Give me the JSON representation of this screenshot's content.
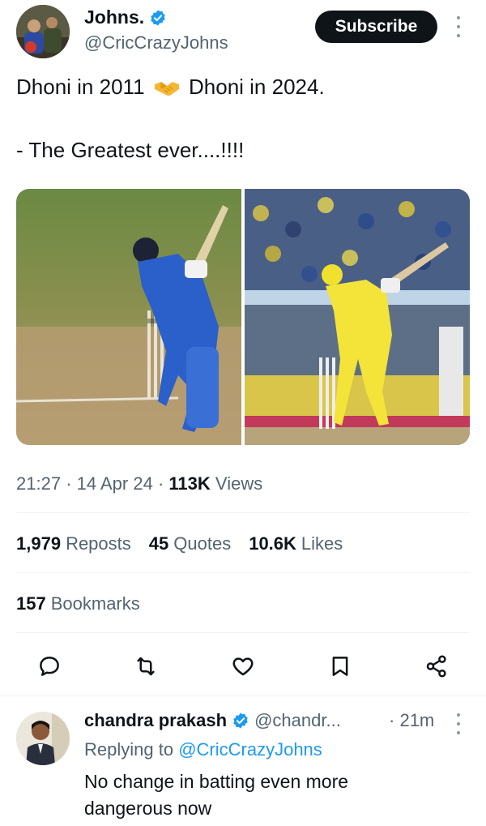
{
  "author": {
    "display_name": "Johns.",
    "handle": "@CricCrazyJohns",
    "verified_icon": "verified-badge-icon"
  },
  "subscribe_label": "Subscribe",
  "tweet": {
    "text_part1": "Dhoni in 2011",
    "emoji": "handshake-icon",
    "text_part2": "Dhoni in 2024.",
    "line2": "- The Greatest ever....!!!!"
  },
  "meta": {
    "time": "21:27",
    "date": "14 Apr 24",
    "views_count": "113K",
    "views_label": "Views"
  },
  "stats": {
    "reposts_count": "1,979",
    "reposts_label": "Reposts",
    "quotes_count": "45",
    "quotes_label": "Quotes",
    "likes_count": "10.6K",
    "likes_label": "Likes",
    "bookmarks_count": "157",
    "bookmarks_label": "Bookmarks"
  },
  "reply": {
    "name": "chandra prakash",
    "handle": "@chandr...",
    "time": "21m",
    "replying_prefix": "Replying to",
    "replying_handle": "@CricCrazyJohns",
    "text": "No change in batting even more dangerous now"
  },
  "colors": {
    "accent": "#1d9bf0",
    "text": "#0f1419",
    "muted": "#536471"
  }
}
